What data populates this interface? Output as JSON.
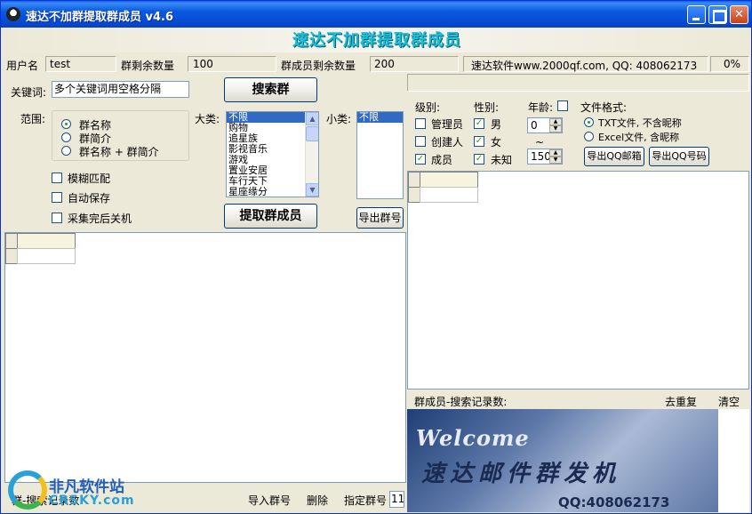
{
  "window": {
    "title": "速达不加群提取群成员   v4.6",
    "banner": "速达不加群提取群成员"
  },
  "info": {
    "username_label": "用户名",
    "username_value": "test",
    "group_remaining_label": "群剩余数量",
    "group_remaining_value": "100",
    "member_remaining_label": "群成员剩余数量",
    "member_remaining_value": "200",
    "company": "速达软件www.2000qf.com, QQ: 408062173",
    "progress": "0%"
  },
  "search": {
    "keyword_label": "关键词:",
    "keyword_value": "多个关键词用空格分隔",
    "search_button": "搜索群",
    "scope_label": "范围:",
    "scope_options": [
      "群名称",
      "群简介",
      "群名称 + 群简介"
    ],
    "scope_selected": 0,
    "fuzzy": "模糊匹配",
    "autosave": "自动保存",
    "shutdown": "采集完后关机",
    "category_label": "大类:",
    "categories": [
      "不限",
      "购物",
      "追星族",
      "影视音乐",
      "游戏",
      "置业安居",
      "车行天下",
      "星座缘分"
    ],
    "subcategory_label": "小类:",
    "subcategories": [
      "不限"
    ],
    "extract_button": "提取群成员",
    "export_groups_button": "导出群号"
  },
  "filters": {
    "level_label": "级别:",
    "levels": [
      "管理员",
      "创建人",
      "成员"
    ],
    "levels_checked": [
      false,
      false,
      true
    ],
    "gender_label": "性别:",
    "genders": [
      "男",
      "女",
      "未知"
    ],
    "genders_checked": [
      true,
      true,
      true
    ],
    "age_label": "年龄:",
    "age_min": "0",
    "age_tilde": "~",
    "age_max": "150",
    "format_label": "文件格式:",
    "formats": [
      "TXT文件, 不含昵称",
      "Excel文件, 含昵称"
    ],
    "format_selected": 0,
    "export_mail_button": "导出QQ邮箱",
    "export_qq_button": "导出QQ号码"
  },
  "members_bar": {
    "count_label": "群成员-搜索记录数:",
    "dedupe": "去重复",
    "clear": "清空"
  },
  "bottom_bar": {
    "group_count_label": "群-搜索记录数:",
    "import": "导入群号",
    "delete": "删除",
    "specify": "指定群号",
    "specify_value": "11"
  },
  "welcome": {
    "line1": "Welcome",
    "line2": "速达邮件群发机",
    "line3": "QQ:408062173"
  },
  "watermark": {
    "line1": "非凡软件站",
    "line2": "CRSKY.com"
  }
}
